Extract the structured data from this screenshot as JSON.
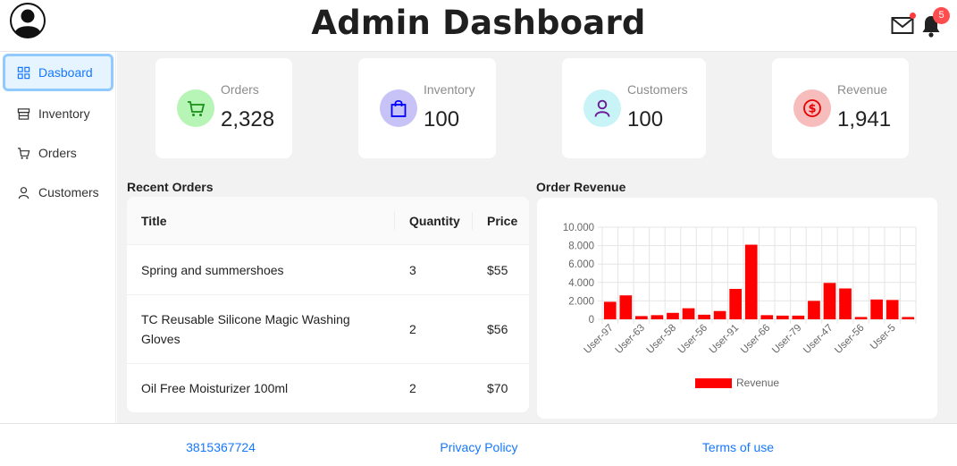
{
  "header": {
    "title": "Admin Dashboard",
    "notification_count": "5"
  },
  "sidebar": {
    "items": [
      {
        "label": "Dasboard",
        "icon": "dashboard-icon",
        "active": true
      },
      {
        "label": "Inventory",
        "icon": "shop-icon",
        "active": false
      },
      {
        "label": "Orders",
        "icon": "cart-icon",
        "active": false
      },
      {
        "label": "Customers",
        "icon": "user-icon",
        "active": false
      }
    ]
  },
  "cards": [
    {
      "label": "Orders",
      "value": "2,328",
      "icon": "cart-icon",
      "color": "#389e0d",
      "bg": "#b7f5b7"
    },
    {
      "label": "Inventory",
      "value": "100",
      "icon": "shopping-bag-icon",
      "color": "#0000ff",
      "bg": "#c7c3f7"
    },
    {
      "label": "Customers",
      "value": "100",
      "icon": "user-icon",
      "color": "#6a1b9a",
      "bg": "#c9f4f7"
    },
    {
      "label": "Revenue",
      "value": "1,941",
      "icon": "dollar-circle-icon",
      "color": "#e60000",
      "bg": "#f7bcbc"
    }
  ],
  "recent_orders": {
    "title": "Recent Orders",
    "columns": [
      "Title",
      "Quantity",
      "Price"
    ],
    "rows": [
      {
        "title": "Spring and summershoes",
        "quantity": "3",
        "price": "$55"
      },
      {
        "title": "TC Reusable Silicone Magic Washing Gloves",
        "quantity": "2",
        "price": "$56"
      },
      {
        "title": "Oil Free Moisturizer 100ml",
        "quantity": "2",
        "price": "$70"
      }
    ]
  },
  "order_revenue": {
    "title": "Order Revenue"
  },
  "chart_data": {
    "type": "bar",
    "title": "",
    "xlabel": "",
    "ylabel": "",
    "ylim": [
      0,
      10000
    ],
    "yticks": [
      "0",
      "2.000",
      "4.000",
      "6.000",
      "8.000",
      "10.000"
    ],
    "categories": [
      "User-97",
      "",
      "User-63",
      "",
      "User-58",
      "",
      "User-56",
      "",
      "User-91",
      "",
      "User-66",
      "",
      "User-79",
      "",
      "User-47",
      "",
      "User-56",
      "",
      "User-5",
      ""
    ],
    "series": [
      {
        "name": "Revenue",
        "color": "#ff0000",
        "values": [
          1900,
          2600,
          350,
          450,
          700,
          1200,
          500,
          900,
          3300,
          8100,
          450,
          400,
          400,
          2000,
          3950,
          3350,
          250,
          2150,
          2100,
          250
        ]
      }
    ],
    "legend": "bottom",
    "grid": true
  },
  "footer": {
    "phone": "3815367724",
    "privacy": "Privacy Policy",
    "terms": "Terms of use"
  }
}
